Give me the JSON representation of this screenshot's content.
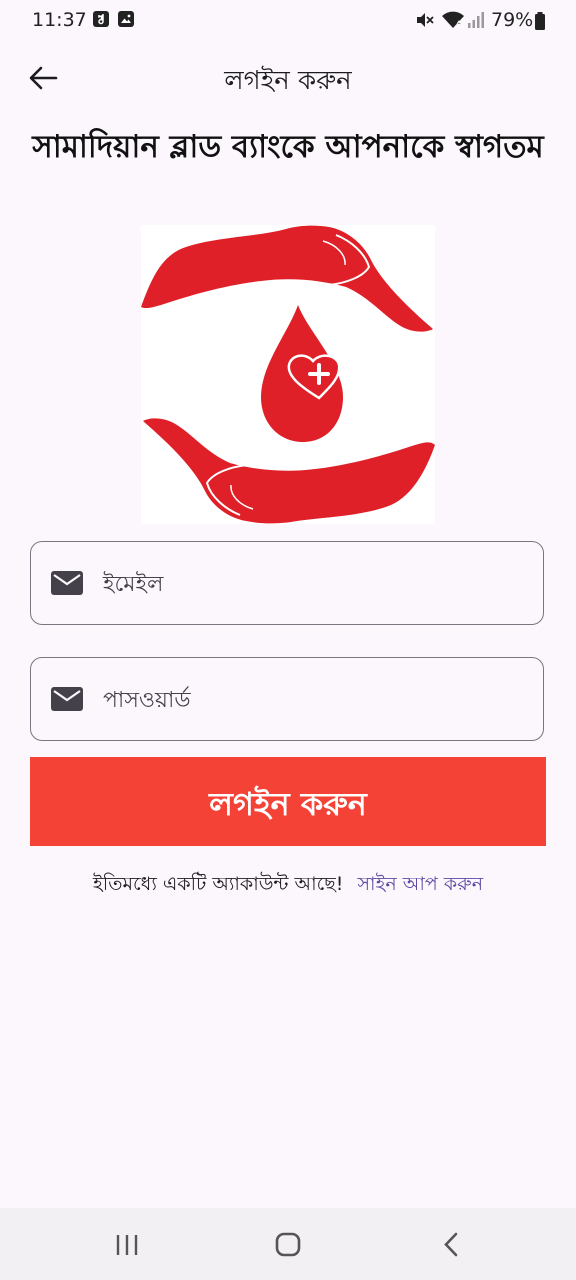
{
  "status_bar": {
    "time": "11:37",
    "battery": "79%"
  },
  "app_bar": {
    "title": "লগইন করুন"
  },
  "welcome_text": "সামাদিয়ান ব্লাড ব্যাংকে আপনাকে স্বাগতম",
  "form": {
    "email_placeholder": "ইমেইল",
    "password_placeholder": "পাসওয়ার্ড",
    "login_button": "লগইন করুন"
  },
  "account": {
    "text": "ইতিমধ্যে একটি অ্যাকাউন্ট আছে!",
    "signup_link": "সাইন আপ করুন"
  },
  "icons": {
    "back": "arrow-left-icon",
    "email": "mail-icon",
    "password": "mail-icon",
    "logo": "blood-drop-hands-logo"
  },
  "colors": {
    "accent": "#f44236",
    "logo_red": "#e02028",
    "link": "#5a4aa3",
    "background": "#fcf6fd"
  }
}
